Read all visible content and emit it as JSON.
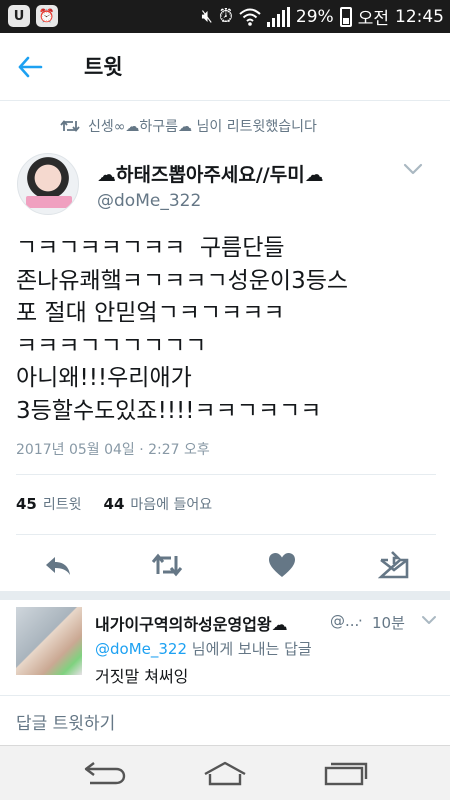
{
  "status_bar": {
    "battery": "29%",
    "ampm": "오전",
    "time": "12:45",
    "left_icons": [
      "u-app-icon",
      "alarm-clock-app-icon"
    ],
    "right_icons": [
      "mute-icon",
      "alarm-icon",
      "wifi-icon",
      "signal-icon",
      "battery-icon"
    ]
  },
  "header": {
    "title": "트윗",
    "back_icon": "arrow-left-icon"
  },
  "retweet_context": "신셍∞☁하구름☁ 님이 리트윗했습니다",
  "tweet": {
    "display_name": "☁하태즈뽑아주세요//두미☁",
    "handle": "@doMe_322",
    "text": "ㄱㅋㄱㅋㅋㄱㅋㅋ  구름단들\n존나유쾌햌ㅋㄱㅋㅋㄱ성운이3등스\n포 절대 안믿엌ㄱㅋㄱㅋㅋㅋ\nㅋㅋㅋㄱㄱㄱㄱㄱㄱ\n아니왜!!!우리애가\n3등할수도있죠!!!!ㅋㅋㄱㅋㄱㅋ",
    "timestamp": "2017년 05월 04일 · 2:27 오후",
    "retweet_count": "45",
    "retweet_label": "리트윗",
    "like_count": "44",
    "like_label": "마음에 들어요"
  },
  "actions": [
    "reply-icon",
    "retweet-icon",
    "heart-icon",
    "direct-message-icon"
  ],
  "reply": {
    "display_name": "내가이구역의하성운영업왕☁",
    "handle": "@...",
    "dot": "·",
    "time": "10분",
    "reply_to_mention": "@doMe_322",
    "reply_to_suffix": " 님에게 보내는 답글",
    "text": "거짓말 쳐써잉"
  },
  "compose_placeholder": "답글 트윗하기",
  "nav": [
    "back-nav-icon",
    "home-nav-icon",
    "recents-nav-icon"
  ],
  "colors": {
    "accent": "#1da1f2",
    "secondary_text": "#657786",
    "divider": "#e6ecf0"
  }
}
